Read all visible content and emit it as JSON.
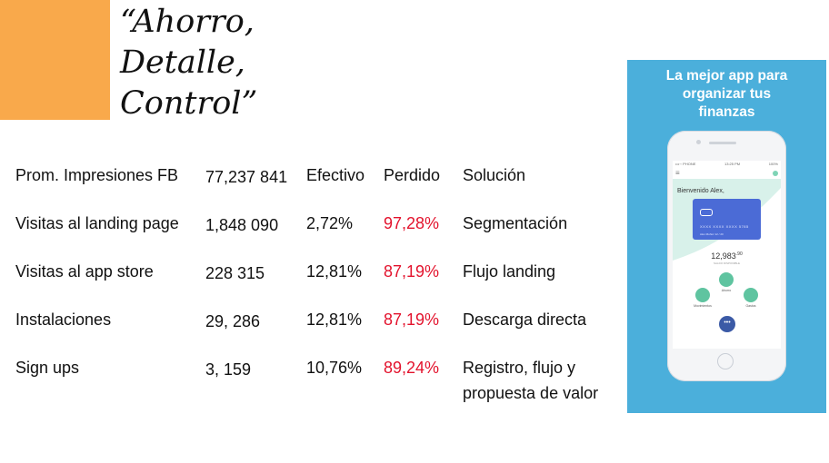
{
  "title": {
    "line1": "“Ahorro,",
    "line2": "Detalle,",
    "line3": "Control”"
  },
  "table": {
    "headers": [
      "Prom. Impresiones FB",
      "77,237 841",
      "Efectivo",
      "Perdido",
      "Solución"
    ],
    "rows": [
      [
        "Visitas al landing page",
        "1,848 090",
        "2,72%",
        "97,28%",
        "Segmentación"
      ],
      [
        "Visitas al app store",
        "228 315",
        "12,81%",
        "87,19%",
        "Flujo landing"
      ],
      [
        "Instalaciones",
        "29, 286",
        "12,81%",
        "87,19%",
        "Descarga directa"
      ],
      [
        "Sign ups",
        "3, 159",
        "10,76%",
        "89,24%",
        "Registro, flujo y",
        "propuesta de valor"
      ]
    ]
  },
  "colors": {
    "accent_orange": "#f9a94b",
    "lost_red": "#e3132d",
    "ad_blue": "#4bafdb"
  },
  "ad": {
    "headline1": "La mejor app para",
    "headline2": "organizar tus",
    "headline3": "finanzas",
    "phone": {
      "status_carrier": "•••◦◦ PHONE",
      "status_time": "13:25 PM",
      "status_battery": "100%",
      "welcome": "Bienvenido Alex,",
      "card_number": "XXXX  XXXX  XXXX  5785",
      "card_name": "Alex Muñoz       12 / 20",
      "balance": "12,983",
      "balance_cents": ".90",
      "balance_label": "SALDO DISPONIBLE",
      "btn_left": "Movimientos",
      "btn_center": "Ahorro",
      "btn_right": "Gastos",
      "fab": "•••"
    }
  }
}
